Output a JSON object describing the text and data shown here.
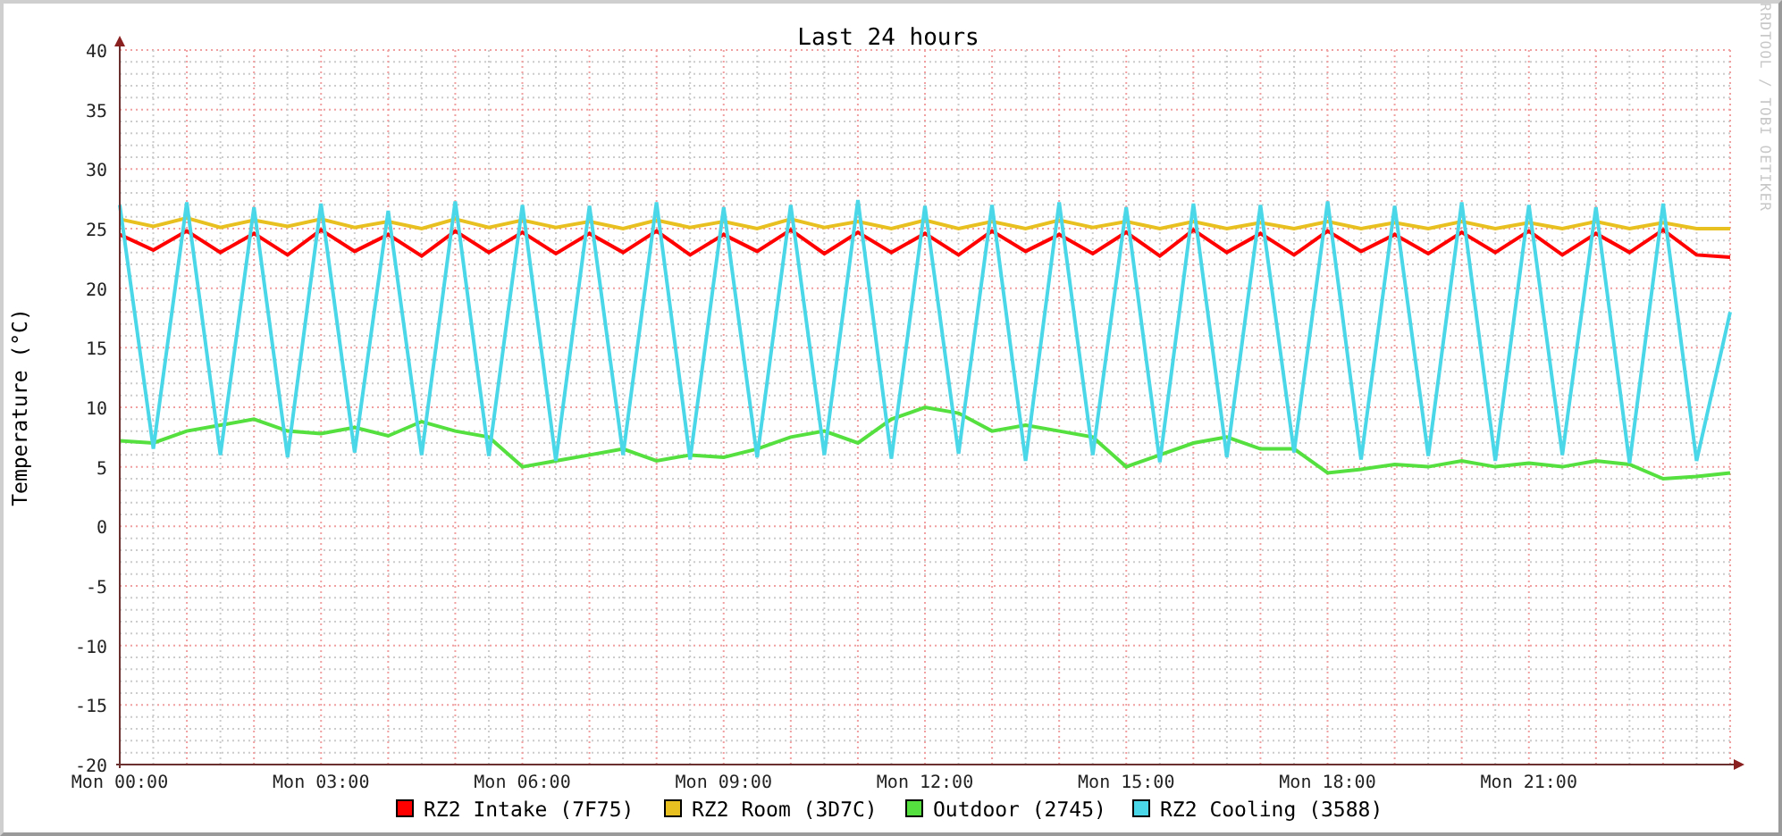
{
  "graph": {
    "credit": "RRDTOOL / TOBI OETIKER",
    "chart_data": {
      "type": "line",
      "title": "Last 24 hours",
      "ylabel": "Temperature (°C)",
      "ylim": [
        -20,
        40
      ],
      "grid": true,
      "legend": "bottom",
      "yticks": [
        -20,
        -15,
        -10,
        -5,
        0,
        5,
        10,
        15,
        20,
        25,
        30,
        35,
        40
      ],
      "categories": [
        "Mon 00:00",
        null,
        null,
        null,
        null,
        null,
        "Mon 03:00",
        null,
        null,
        null,
        null,
        null,
        "Mon 06:00",
        null,
        null,
        null,
        null,
        null,
        "Mon 09:00",
        null,
        null,
        null,
        null,
        null,
        "Mon 12:00",
        null,
        null,
        null,
        null,
        null,
        "Mon 15:00",
        null,
        null,
        null,
        null,
        null,
        "Mon 18:00",
        null,
        null,
        null,
        null,
        null,
        "Mon 21:00",
        null,
        null,
        null,
        null,
        null,
        null
      ],
      "series": [
        {
          "name": "RZ2 Intake (7F75)",
          "color": "#ff0000",
          "values": [
            24.5,
            23.2,
            24.8,
            23.0,
            24.6,
            22.8,
            24.9,
            23.1,
            24.5,
            22.7,
            24.8,
            23.0,
            24.7,
            22.9,
            24.6,
            23.0,
            24.8,
            22.8,
            24.5,
            23.1,
            24.9,
            22.9,
            24.7,
            23.0,
            24.6,
            22.8,
            24.8,
            23.1,
            24.5,
            22.9,
            24.7,
            22.7,
            24.9,
            23.0,
            24.6,
            22.8,
            24.8,
            23.1,
            24.5,
            22.9,
            24.7,
            23.0,
            24.8,
            22.8,
            24.6,
            23.0,
            24.9,
            22.8,
            22.6
          ]
        },
        {
          "name": "RZ2 Room (3D7C)",
          "color": "#e8c020",
          "values": [
            25.8,
            25.2,
            25.9,
            25.1,
            25.7,
            25.2,
            25.8,
            25.1,
            25.6,
            25.0,
            25.8,
            25.1,
            25.7,
            25.1,
            25.6,
            25.0,
            25.7,
            25.1,
            25.6,
            25.0,
            25.8,
            25.1,
            25.6,
            25.0,
            25.7,
            25.0,
            25.6,
            25.0,
            25.7,
            25.1,
            25.6,
            25.0,
            25.6,
            25.0,
            25.5,
            25.0,
            25.6,
            25.0,
            25.5,
            25.0,
            25.6,
            25.0,
            25.5,
            25.0,
            25.6,
            25.0,
            25.5,
            25.0,
            25.0
          ]
        },
        {
          "name": "Outdoor (2745)",
          "color": "#55e040",
          "values": [
            7.2,
            7.0,
            8.0,
            8.5,
            9.0,
            8.0,
            7.8,
            8.3,
            7.6,
            8.8,
            8.0,
            7.5,
            5.0,
            5.5,
            6.0,
            6.5,
            5.5,
            6.0,
            5.8,
            6.5,
            7.5,
            8.0,
            7.0,
            9.0,
            10.0,
            9.5,
            8.0,
            8.5,
            8.0,
            7.5,
            5.0,
            6.0,
            7.0,
            7.5,
            6.5,
            6.5,
            4.5,
            4.8,
            5.2,
            5.0,
            5.5,
            5.0,
            5.3,
            5.0,
            5.5,
            5.2,
            4.0,
            4.2,
            4.5
          ]
        },
        {
          "name": "RZ2 Cooling (3588)",
          "color": "#4ad8e8",
          "values": [
            27.0,
            6.5,
            27.2,
            6.0,
            26.8,
            5.8,
            27.1,
            6.2,
            26.5,
            6.0,
            27.3,
            5.9,
            27.0,
            5.5,
            26.9,
            6.0,
            27.2,
            5.6,
            26.8,
            5.8,
            27.0,
            6.0,
            27.4,
            5.7,
            26.9,
            6.1,
            27.0,
            5.5,
            27.2,
            6.0,
            26.8,
            5.4,
            27.1,
            5.8,
            27.0,
            6.2,
            27.3,
            5.6,
            26.9,
            5.9,
            27.2,
            5.5,
            27.0,
            6.0,
            26.8,
            5.3,
            27.1,
            5.5,
            18.0
          ]
        }
      ]
    }
  }
}
